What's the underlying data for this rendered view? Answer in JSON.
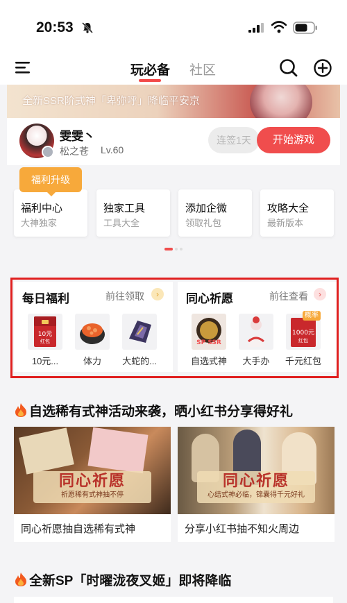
{
  "status_bar": {
    "time": "20:53"
  },
  "nav": {
    "tabs": [
      {
        "label": "玩必备"
      },
      {
        "label": "社区"
      }
    ]
  },
  "hero": {
    "text": "全新SSR阶式神「卑弥呼」降临平安京"
  },
  "profile": {
    "nickname": "雯雯丶",
    "server": "松之苍",
    "level": "Lv.60",
    "checkin_label": "连签1天",
    "start_label": "开始游戏"
  },
  "upgrade_tag": "福利升级",
  "shortcuts": [
    {
      "title": "福利中心",
      "subtitle": "大神独家"
    },
    {
      "title": "独家工具",
      "subtitle": "工具大全"
    },
    {
      "title": "添加企微",
      "subtitle": "领取礼包"
    },
    {
      "title": "攻略大全",
      "subtitle": "最新版本"
    }
  ],
  "daily_welfare": {
    "title": "每日福利",
    "link": "前往领取",
    "items": [
      {
        "label": "10元...",
        "image_text": "10元红包"
      },
      {
        "label": "体力"
      },
      {
        "label": "大蛇的..."
      }
    ]
  },
  "prayer": {
    "title": "同心祈愿",
    "link": "前往查看",
    "items": [
      {
        "label": "自选式神",
        "image_text": "SP SSR"
      },
      {
        "label": "大手办"
      },
      {
        "label": "千元红包",
        "image_text": "1000元红包",
        "badge": "概率"
      }
    ]
  },
  "section1": {
    "title": "自选稀有式神活动来袭，晒小红书分享得好礼"
  },
  "promos": [
    {
      "overlay_title": "同心祈愿",
      "overlay_sub": "祈愿稀有式神抽不停",
      "caption": "同心祈愿抽自选稀有式神"
    },
    {
      "overlay_title": "同心祈愿",
      "overlay_sub": "心结式神必临，锦囊得千元好礼",
      "caption": "分享小红书抽不知火周边"
    }
  ],
  "section2": {
    "title": "全新SP「时曜泷夜叉姬」即将降临"
  },
  "colors": {
    "accent": "#f04d4d",
    "highlight_border": "#e01f1f",
    "tag": "#f7a93b"
  }
}
